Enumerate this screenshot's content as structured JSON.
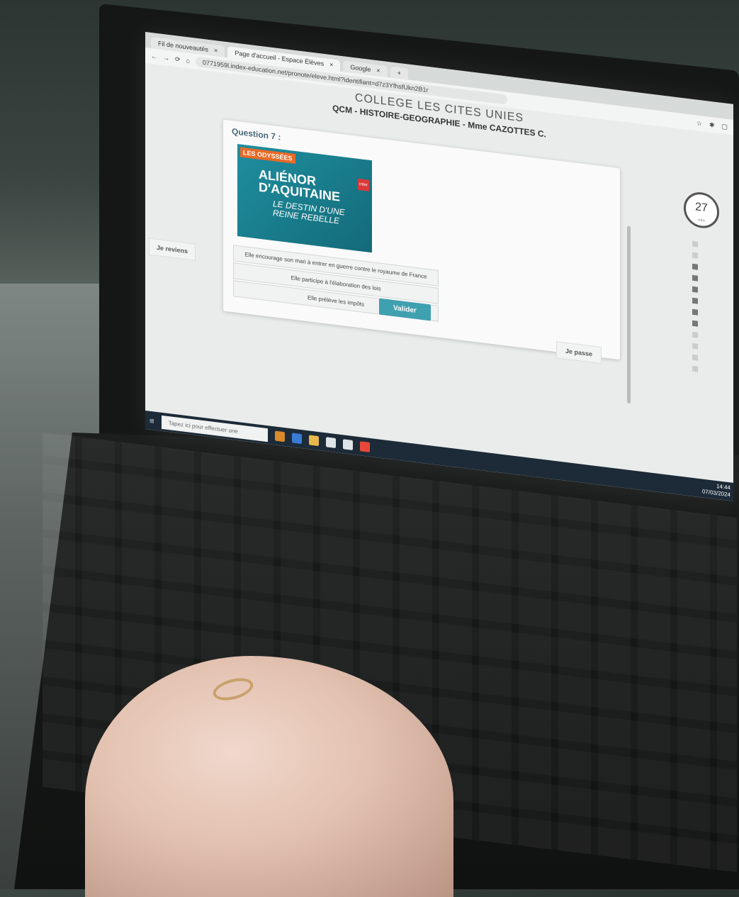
{
  "browser": {
    "tabs": [
      {
        "label": "Fil de nouveautés"
      },
      {
        "label": "Page d'accueil - Espace Élèves"
      },
      {
        "label": "Google"
      }
    ],
    "url": "0771959l.index-education.net/pronote/eleve.html?identifiant=d7z3YfhsfUkn2B1r"
  },
  "page": {
    "school": "COLLEGE LES CITES UNIES",
    "title": "QCM - HISTOIRE-GEOGRAPHIE - Mme CAZOTTES C."
  },
  "question": {
    "label": "Question 7 :",
    "image": {
      "series": "LES ODYSSÉES",
      "title": "ALIÉNOR D'AQUITAINE",
      "subtitle": "LE DESTIN D'UNE REINE REBELLE",
      "badge": "inter"
    },
    "answers": [
      "Elle encourage son mari à entrer en guerre contre le royaume de France",
      "Elle participe à l'élaboration des lois",
      "Elle prélève les impôts"
    ]
  },
  "buttons": {
    "back": "Je reviens",
    "validate": "Valider",
    "skip": "Je passe"
  },
  "timer": {
    "value": "27",
    "unit": "min"
  },
  "progress": {
    "done": 6,
    "total": 12
  },
  "taskbar": {
    "search_placeholder": "Tapez ici pour effectuer une",
    "time": "14:44",
    "date": "07/03/2024"
  }
}
